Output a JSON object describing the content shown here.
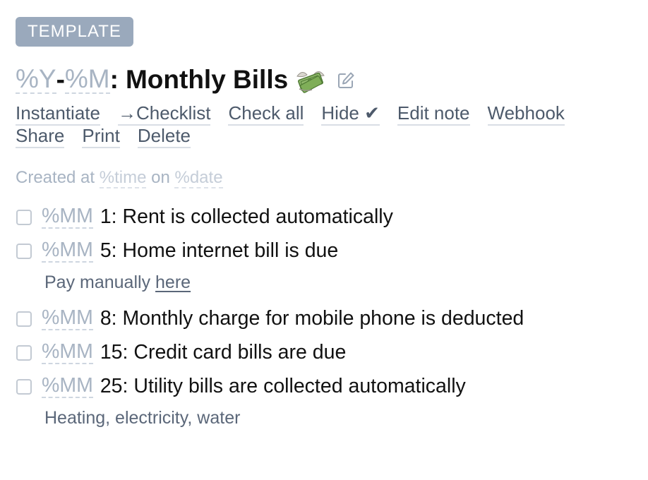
{
  "badge": "TEMPLATE",
  "title": {
    "year_token": "%Y",
    "dash": "-",
    "month_token": "%M",
    "separator": ":",
    "text": "Monthly Bills",
    "emoji_icon": "money-with-wings-icon",
    "edit_icon": "edit-icon"
  },
  "actions": {
    "row1": [
      "Instantiate",
      "→Checklist",
      "Check all",
      "Hide ✔",
      "Edit note",
      "Webhook"
    ],
    "row2": [
      "Share",
      "Print",
      "Delete"
    ]
  },
  "created": {
    "prefix": "Created at",
    "time_token": "%time",
    "on": "on",
    "date_token": "%date"
  },
  "items": [
    {
      "token": "%MM",
      "text": "1: Rent is collected automatically"
    },
    {
      "token": "%MM",
      "text": "5: Home internet bill is due",
      "note_prefix": "Pay manually",
      "note_link": "here"
    },
    {
      "token": "%MM",
      "text": "8: Monthly charge for mobile phone is deducted"
    },
    {
      "token": "%MM",
      "text": "15: Credit card bills are due"
    },
    {
      "token": "%MM",
      "text": "25: Utility bills are collected automatically",
      "note_text": "Heating, electricity, water"
    }
  ],
  "colors": {
    "badge_bg": "#9aa9bc",
    "placeholder": "#a8b4c3",
    "action_text": "#4d5a6b",
    "note_text": "#5b6779"
  }
}
